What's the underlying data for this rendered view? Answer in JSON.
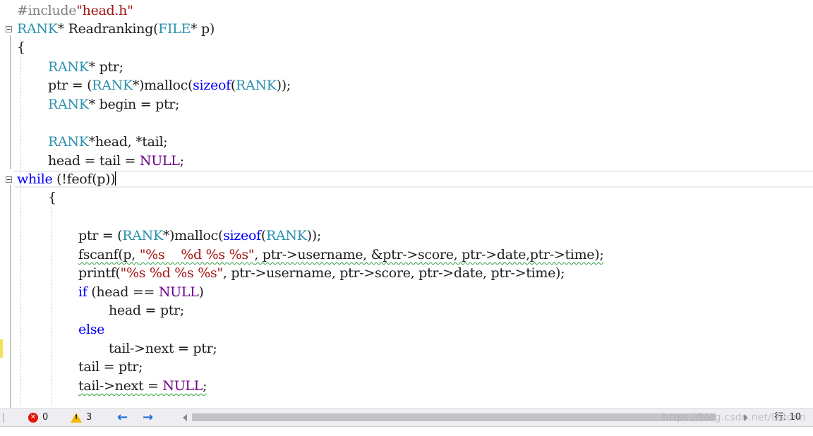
{
  "editor": {
    "line1": {
      "pp": "#include",
      "str": "\"head.h\""
    },
    "line2": {
      "ty": "RANK",
      "t1": "* Readranking(",
      "ty2": "FILE",
      "t2": "* p)"
    },
    "line3": {
      "t": "{"
    },
    "line5": {
      "ty": "RANK",
      "t": "* ptr;"
    },
    "line6": {
      "a": "ptr = (",
      "ty": "RANK",
      "b": "*)malloc(",
      "kw": "sizeof",
      "c": "(",
      "ty2": "RANK",
      "d": "));"
    },
    "line7": {
      "ty": "RANK",
      "t": "* begin = ptr;"
    },
    "line9": {
      "ty": "RANK",
      "t": "*head, *tail;"
    },
    "line10": {
      "a": "head = tail = ",
      "mac": "NULL",
      "b": ";"
    },
    "line11": {
      "kw": "while",
      "t": " (!feof(p))"
    },
    "line12": {
      "t": "{"
    },
    "line14": {
      "a": "ptr = (",
      "ty": "RANK",
      "b": "*)malloc(",
      "kw": "sizeof",
      "c": "(",
      "ty2": "RANK",
      "d": "));"
    },
    "line15": {
      "a": "fscanf(p, ",
      "str": "\"%s    %d %s %s\"",
      "b": ", ptr->username, &ptr->score, ptr->date,ptr->time);"
    },
    "line16": {
      "a": "printf(",
      "str": "\"%s %d %s %s\"",
      "b": ", ptr->username, ptr->score, ptr->date, ptr->time);"
    },
    "line17": {
      "kw": "if",
      "a": " (head == ",
      "mac": "NULL",
      "b": ")"
    },
    "line18": {
      "t": "head = ptr;"
    },
    "line19": {
      "kw": "else"
    },
    "line20": {
      "t": "tail->next = ptr;"
    },
    "line21": {
      "t": "tail = ptr;"
    },
    "line22": {
      "a": "tail->next = ",
      "mac": "NULL",
      "b": ";"
    }
  },
  "statusbar": {
    "errors": "0",
    "warnings": "3",
    "nav_back": "←",
    "nav_forward": "→",
    "position": "行: 10"
  },
  "watermark": "https://blog.csdn.net/lx2dnn",
  "colors": {
    "keyword": "#0000ff",
    "type": "#2b91af",
    "macro": "#6f008a",
    "string": "#a31515",
    "preprocessor": "#808080"
  }
}
